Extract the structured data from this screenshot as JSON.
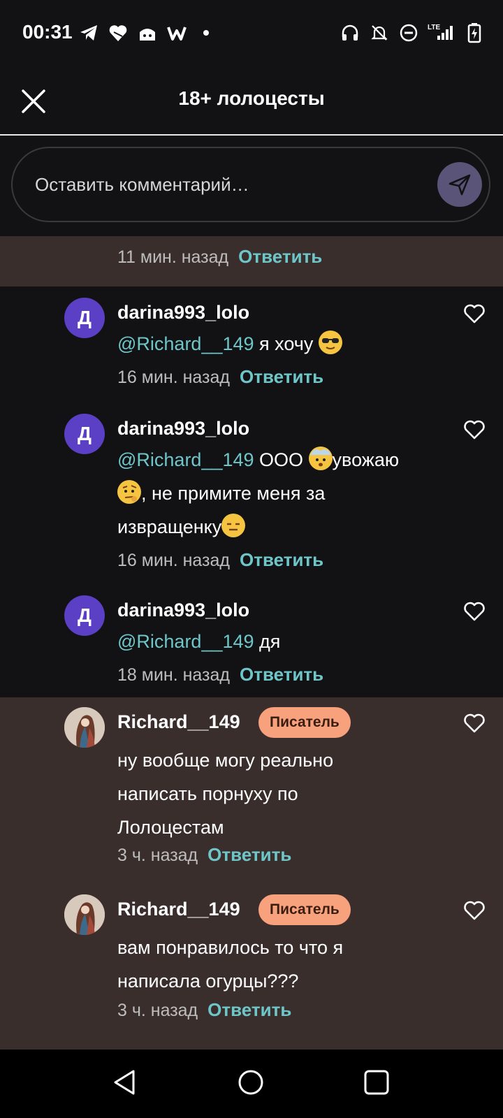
{
  "status": {
    "time": "00:31",
    "left_icons": [
      "telegram-icon",
      "heart-app-icon",
      "neko-app-icon",
      "w-app-icon",
      "dot-icon"
    ],
    "right_icons": [
      "headphones-icon",
      "bell-off-icon",
      "dnd-icon",
      "lte-signal-icon",
      "battery-icon"
    ],
    "lte_label": "LTE"
  },
  "header": {
    "title": "18+ лолоцесты",
    "close_icon": "close-icon"
  },
  "comment_box": {
    "placeholder": "Оставить комментарий…",
    "value": "",
    "send_icon": "send-icon"
  },
  "partial": {
    "time": "11 мин. назад",
    "reply": "Ответить"
  },
  "comments": [
    {
      "username": "darina993_lolo",
      "avatar_letter": "Д",
      "mention": "@Richard__149",
      "text": " я хочу",
      "emoji": "sunglasses-emoji",
      "time": "16 мин. назад",
      "reply": "Ответить"
    },
    {
      "username": "darina993_lolo",
      "avatar_letter": "Д",
      "mention": "@Richard__149",
      "text_a": " ООО ",
      "emoji_a": "exploding-head-emoji",
      "text_b": "увожаю",
      "emoji_b": "raised-eyebrow-emoji",
      "text_c": ", не примите меня за извращенку",
      "emoji_c": "expressionless-emoji",
      "time": "16 мин. назад",
      "reply": "Ответить"
    },
    {
      "username": "darina993_lolo",
      "avatar_letter": "Д",
      "mention": "@Richard__149",
      "text": " дя",
      "time": "18 мин. назад",
      "reply": "Ответить"
    },
    {
      "username": "Richard__149",
      "badge": "Писатель",
      "text": "ну вообще могу реально написать порнуху по Лолоцестам",
      "time": "3 ч. назад",
      "reply": "Ответить"
    },
    {
      "username": "Richard__149",
      "badge": "Писатель",
      "text": "вам понравилось то что я написала огурцы???",
      "time": "3 ч. назад",
      "reply": "Ответить"
    }
  ],
  "colors": {
    "background": "#121214",
    "highlight": "#3a2e2c",
    "accent": "#6ec6c9",
    "badge": "#f7a27d",
    "avatar": "#5b3fc4"
  },
  "navbar": {
    "icons": [
      "back-icon",
      "home-icon",
      "recents-icon"
    ]
  }
}
